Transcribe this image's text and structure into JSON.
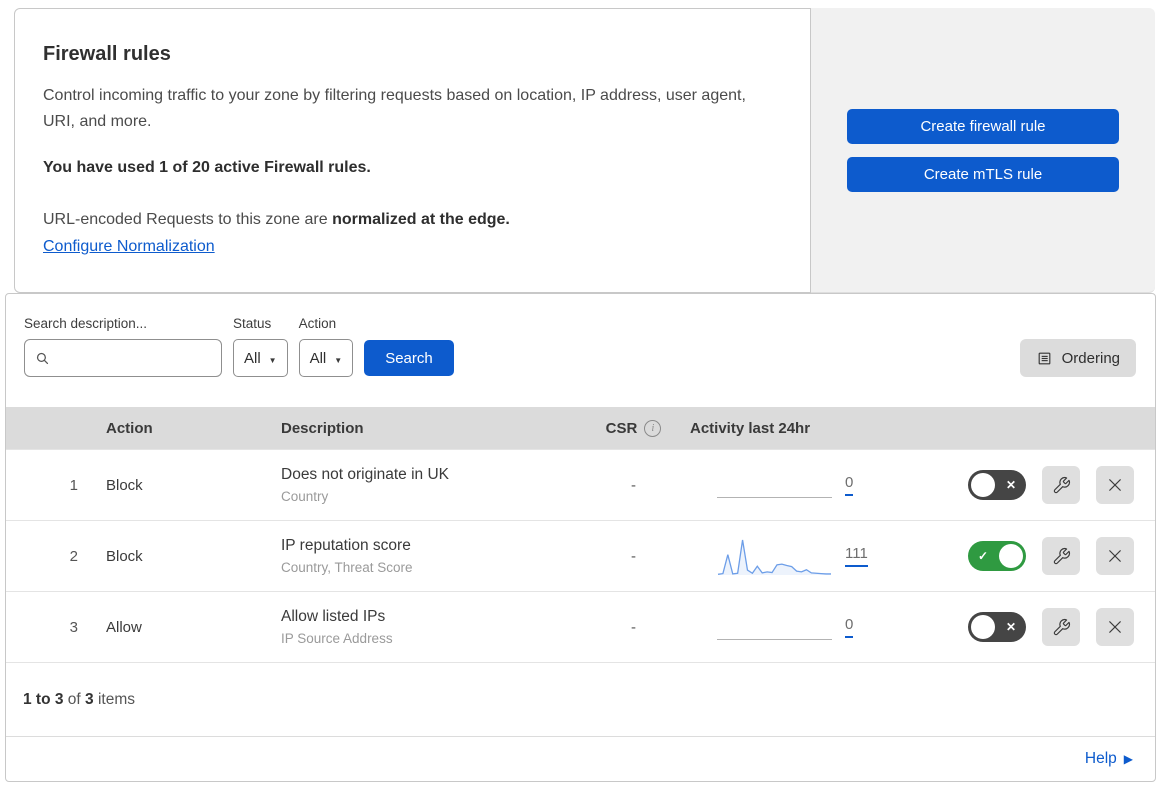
{
  "intro": {
    "title": "Firewall rules",
    "description": "Control incoming traffic to your zone by filtering requests based on location, IP address, user agent, URI, and more.",
    "usage_bold": "You have used 1 of 20 active Firewall rules.",
    "normalization_prefix": "URL-encoded Requests to this zone are ",
    "normalization_bold": "normalized at the edge.",
    "normalization_link": "Configure Normalization"
  },
  "cta": {
    "create_firewall_label": "Create firewall rule",
    "create_mtls_label": "Create mTLS rule"
  },
  "filters": {
    "search_label": "Search description...",
    "search_value": "",
    "status_label": "Status",
    "status_value": "All",
    "action_label": "Action",
    "action_value": "All",
    "search_button_label": "Search",
    "ordering_button_label": "Ordering"
  },
  "table": {
    "headers": {
      "action": "Action",
      "description": "Description",
      "csr": "CSR",
      "activity": "Activity last 24hr"
    },
    "rows": [
      {
        "priority": "1",
        "action": "Block",
        "description": "Does not originate in UK",
        "fields": "Country",
        "csr": "-",
        "activity_count": "0",
        "enabled": false,
        "has_sparkline": false
      },
      {
        "priority": "2",
        "action": "Block",
        "description": "IP reputation score",
        "fields": "Country, Threat Score",
        "csr": "-",
        "activity_count": "111",
        "enabled": true,
        "has_sparkline": true
      },
      {
        "priority": "3",
        "action": "Allow",
        "description": "Allow listed IPs",
        "fields": "IP Source Address",
        "csr": "-",
        "activity_count": "0",
        "enabled": false,
        "has_sparkline": false
      }
    ],
    "footer": {
      "range_bold": "1 to 3",
      "of_text": " of ",
      "total_bold": "3",
      "items_text": " items"
    }
  },
  "help": {
    "label": "Help"
  },
  "chart_data": {
    "type": "area",
    "context": "activity-last-24hr-sparkline-rule-2",
    "title": "Activity last 24hr",
    "x": [
      0,
      1,
      2,
      3,
      4,
      5,
      6,
      7,
      8,
      9,
      10,
      11,
      12,
      13,
      14,
      15,
      16,
      17,
      18,
      19,
      20,
      21,
      22,
      23
    ],
    "values": [
      2,
      4,
      58,
      3,
      5,
      100,
      14,
      5,
      25,
      6,
      9,
      7,
      29,
      31,
      27,
      24,
      11,
      9,
      15,
      6,
      5,
      4,
      3,
      3
    ],
    "total_label": "111",
    "ylim": [
      0,
      100
    ],
    "grid": false,
    "legend": false
  },
  "colors": {
    "accent_blue": "#0d5bcd",
    "link_blue": "#0d5bcd",
    "toggle_on_green": "#2f9a41",
    "toggle_off_gray": "#454545",
    "sparkline_line": "#6d9ee8",
    "sparkline_fill": "#edf3fc",
    "table_header_bg": "#dbdbdb",
    "cta_panel_bg": "#f1f1f1",
    "icon_button_bg": "#dfdfdf"
  }
}
